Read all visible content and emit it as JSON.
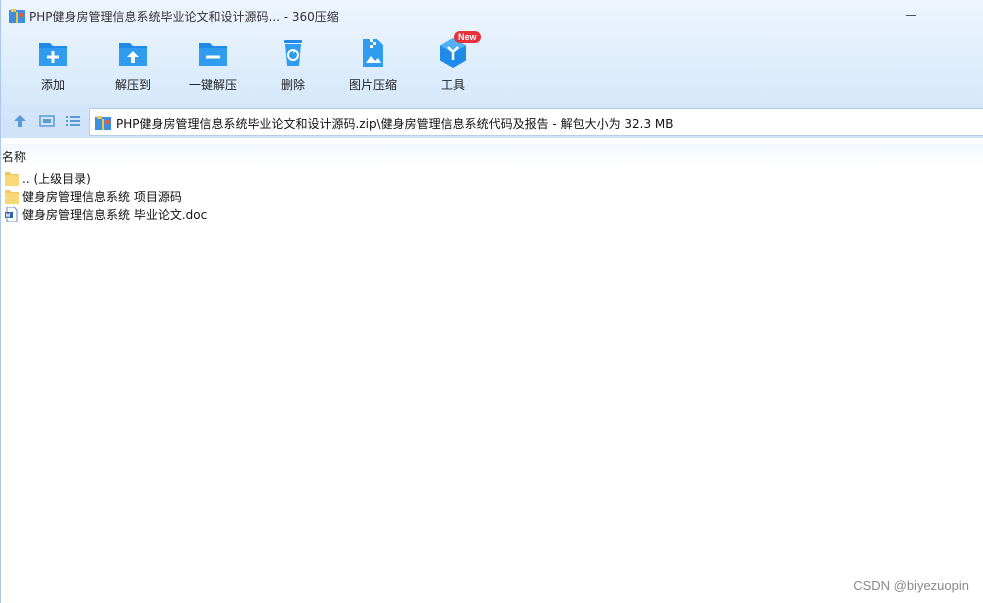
{
  "window": {
    "title": "PHP健身房管理信息系统毕业论文和设计源码... - 360压缩",
    "app_icon": "zip-archive-icon"
  },
  "toolbar": {
    "items": [
      {
        "label": "添加",
        "icon": "add-folder-icon"
      },
      {
        "label": "解压到",
        "icon": "extract-to-icon"
      },
      {
        "label": "一键解压",
        "icon": "one-click-extract-icon"
      },
      {
        "label": "删除",
        "icon": "recycle-bin-icon"
      },
      {
        "label": "图片压缩",
        "icon": "image-compress-icon"
      },
      {
        "label": "工具",
        "icon": "tools-icon",
        "badge": "New"
      }
    ]
  },
  "address": {
    "path": "PHP健身房管理信息系统毕业论文和设计源码.zip\\健身房管理信息系统代码及报告 - 解包大小为 32.3 MB"
  },
  "list": {
    "column_name": "名称",
    "items": [
      {
        "name": ".. (上级目录)",
        "type": "parent-folder"
      },
      {
        "name": "健身房管理信息系统 项目源码",
        "type": "folder"
      },
      {
        "name": "健身房管理信息系统 毕业论文.doc",
        "type": "doc"
      }
    ]
  },
  "watermark": "CSDN @biyezuopin",
  "colors": {
    "accent_blue": "#1e88e5",
    "toolbar_bg": "#dfeefc",
    "folder_yellow": "#f9d977",
    "badge_red": "#e8313a"
  }
}
